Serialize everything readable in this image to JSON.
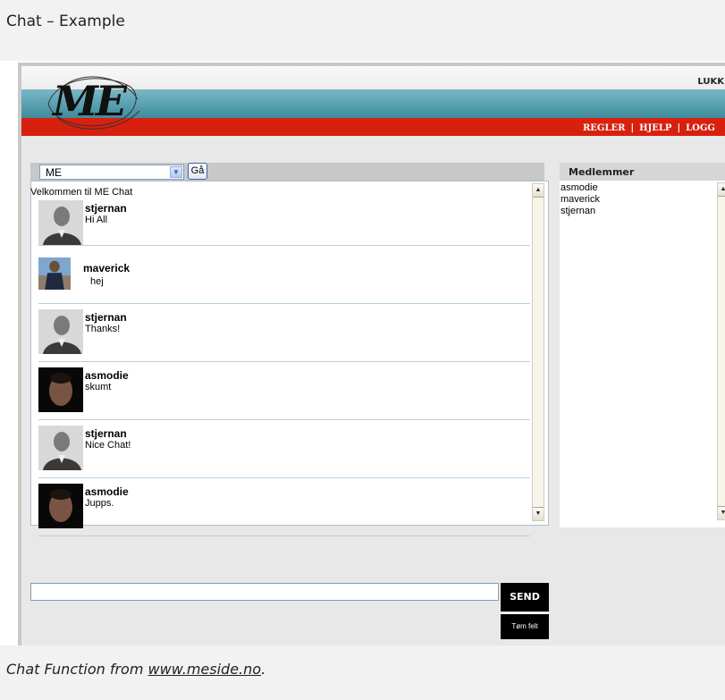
{
  "doc": {
    "title": "Chat – Example",
    "caption_prefix": "Chat Function from ",
    "caption_link": "www.meside.no",
    "caption_suffix": "."
  },
  "header": {
    "logo_text": "ME",
    "top_link": "LUKK",
    "nav": [
      "REGLER",
      "HJELP",
      "LOGG"
    ]
  },
  "room": {
    "selected": "ME",
    "go_label": "Gå"
  },
  "chat": {
    "welcome": "Velkommen til ME Chat",
    "messages": [
      {
        "user": "stjernan",
        "text": "Hi All"
      },
      {
        "user": "maverick",
        "text": "hej"
      },
      {
        "user": "stjernan",
        "text": "Thanks!"
      },
      {
        "user": "asmodie",
        "text": "skumt"
      },
      {
        "user": "stjernan",
        "text": "Nice Chat!"
      },
      {
        "user": "asmodie",
        "text": "Jupps."
      }
    ]
  },
  "members": {
    "title": "Medlemmer",
    "list": [
      "asmodie",
      "maverick",
      "stjernan"
    ]
  },
  "input": {
    "value": "",
    "send_label": "SEND",
    "clear_label": "Tøm felt"
  },
  "colors": {
    "red_bar": "#d8200e",
    "teal_banner": "#4f9aab",
    "panel_bg": "#e8e8e8"
  }
}
